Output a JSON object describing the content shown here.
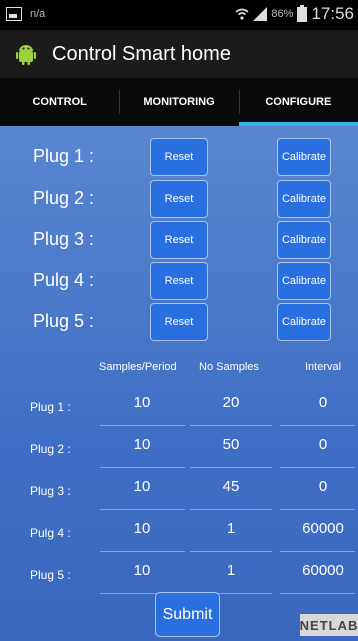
{
  "status_bar": {
    "left_text": "n/a",
    "battery": "86%",
    "time": "17:56",
    "icons": [
      "image-icon",
      "wifi-icon",
      "signal-icon",
      "battery-icon"
    ]
  },
  "action_bar": {
    "title": "Control Smart home",
    "icon": "android-robot-icon"
  },
  "tabs": [
    {
      "label": "CONTROL",
      "active": false
    },
    {
      "label": "MONITORING",
      "active": false
    },
    {
      "label": "CONFIGURE",
      "active": true
    }
  ],
  "plugs": [
    {
      "label": "Plug 1 :",
      "reset_label": "Reset",
      "calibrate_label": "Calibrate"
    },
    {
      "label": "Plug 2 :",
      "reset_label": "Reset",
      "calibrate_label": "Calibrate"
    },
    {
      "label": "Plug 3 :",
      "reset_label": "Reset",
      "calibrate_label": "Calibrate"
    },
    {
      "label": "Pulg 4 :",
      "reset_label": "Reset",
      "calibrate_label": "Calibrate"
    },
    {
      "label": "Plug 5 :",
      "reset_label": "Reset",
      "calibrate_label": "Calibrate"
    }
  ],
  "config_table": {
    "headers": [
      "Samples/Period",
      "No Samples",
      "Interval"
    ],
    "rows": [
      {
        "label": "Plug 1 :",
        "samples_period": "10",
        "no_samples": "20",
        "interval": "0"
      },
      {
        "label": "Plug 2 :",
        "samples_period": "10",
        "no_samples": "50",
        "interval": "0"
      },
      {
        "label": "Plug 3 :",
        "samples_period": "10",
        "no_samples": "45",
        "interval": "0"
      },
      {
        "label": "Pulg 4 :",
        "samples_period": "10",
        "no_samples": "1",
        "interval": "60000"
      },
      {
        "label": "Plug 5 :",
        "samples_period": "10",
        "no_samples": "1",
        "interval": "60000"
      }
    ]
  },
  "submit_label": "Submit",
  "watermark": "NETLAB",
  "colors": {
    "background": "#4a79c9",
    "button": "#2a6fe0",
    "tab_indicator": "#33b5e5",
    "action_bar": "#1b1b1b"
  }
}
